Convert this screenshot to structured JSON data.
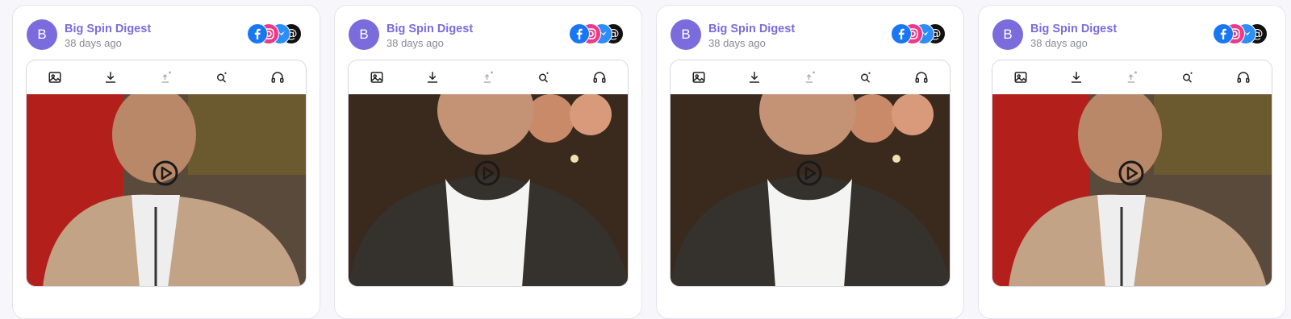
{
  "colors": {
    "accent": "#7a6cdc",
    "muted": "#8a8a96",
    "facebook": "#1877f2",
    "instagram": "#ea3a88",
    "messenger": "#2c8ef8",
    "threads": "#111111"
  },
  "cards": [
    {
      "avatar_letter": "B",
      "author": "Big Spin Digest",
      "timestamp": "38 days ago",
      "scene": "tan-jacket"
    },
    {
      "avatar_letter": "B",
      "author": "Big Spin Digest",
      "timestamp": "38 days ago",
      "scene": "dark-blazer"
    },
    {
      "avatar_letter": "B",
      "author": "Big Spin Digest",
      "timestamp": "38 days ago",
      "scene": "dark-blazer"
    },
    {
      "avatar_letter": "B",
      "author": "Big Spin Digest",
      "timestamp": "38 days ago",
      "scene": "tan-jacket"
    }
  ],
  "toolbar_icons": [
    "image-icon",
    "download-icon",
    "upload-disabled-icon",
    "search-magic-icon",
    "headphones-icon"
  ],
  "social_icons": [
    "facebook-icon",
    "instagram-icon",
    "messenger-icon",
    "threads-icon"
  ]
}
